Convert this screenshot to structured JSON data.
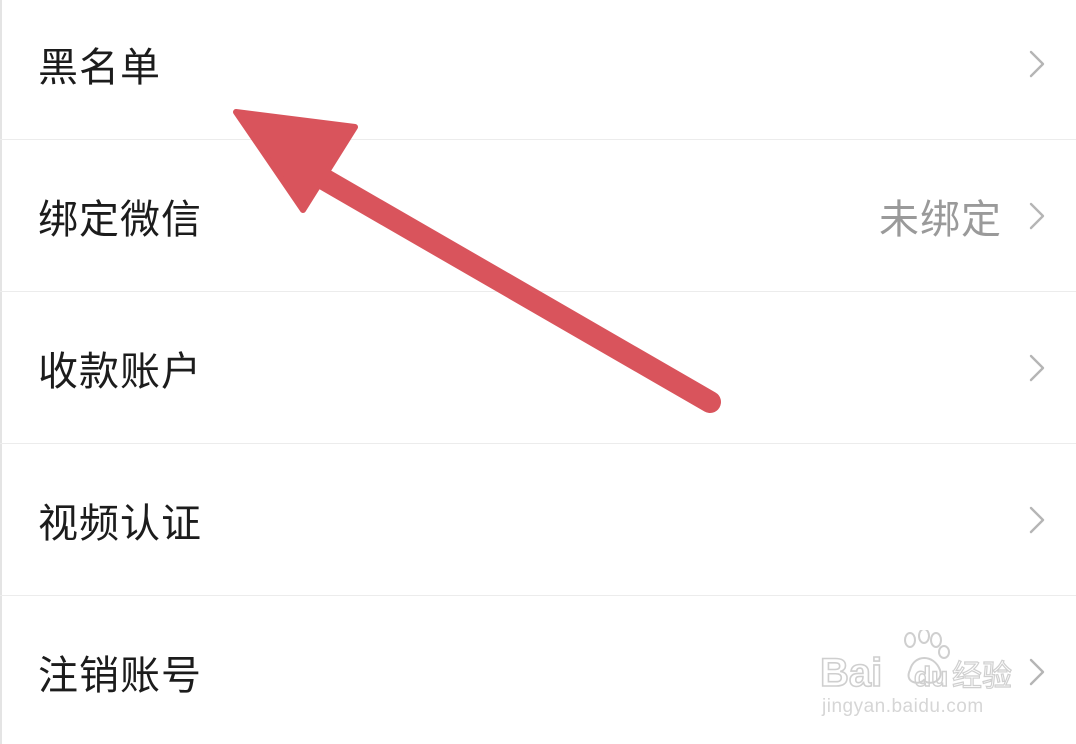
{
  "settings": {
    "items": [
      {
        "label": "黑名单",
        "value": ""
      },
      {
        "label": "绑定微信",
        "value": "未绑定"
      },
      {
        "label": "收款账户",
        "value": ""
      },
      {
        "label": "视频认证",
        "value": ""
      },
      {
        "label": "注销账号",
        "value": ""
      }
    ]
  },
  "annotation": {
    "color": "#d9545c",
    "icon": "arrow-up-left"
  },
  "watermark": {
    "brand": "Baidu",
    "product": "经验",
    "url": "jingyan.baidu.com"
  },
  "colors": {
    "label": "#1c1c1c",
    "value": "#9a9a9a",
    "chevron": "#b5b5b5",
    "divider": "#ececec"
  }
}
